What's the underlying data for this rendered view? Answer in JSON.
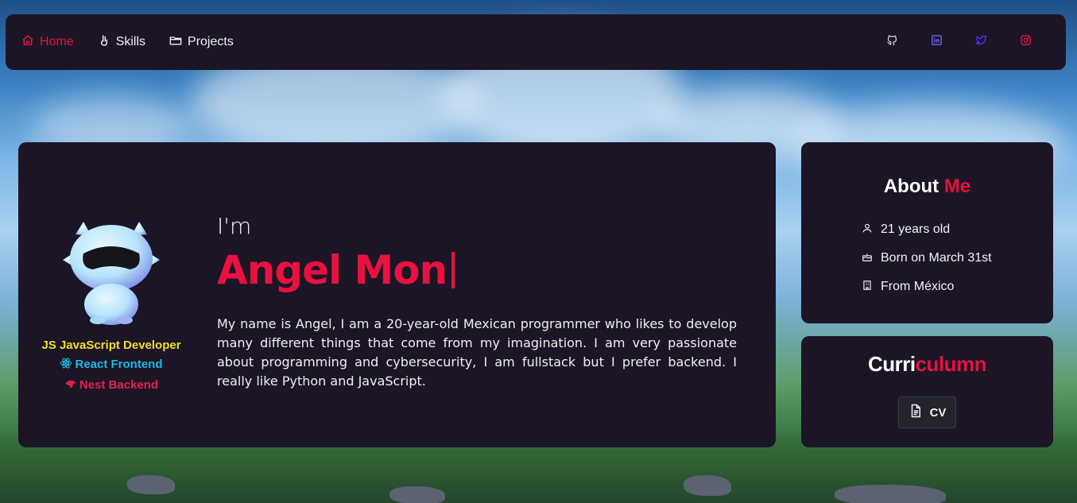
{
  "nav": {
    "items": [
      {
        "label": "Home",
        "icon": "home-icon",
        "active": true
      },
      {
        "label": "Skills",
        "icon": "hand-icon",
        "active": false
      },
      {
        "label": "Projects",
        "icon": "folder-icon",
        "active": false
      }
    ],
    "socials": [
      {
        "icon": "github-icon",
        "color": "#d9d9d9"
      },
      {
        "icon": "linkedin-icon",
        "color": "#6a63ff"
      },
      {
        "icon": "twitter-icon",
        "color": "#5a2bff"
      },
      {
        "icon": "instagram-icon",
        "color": "#e8113f"
      }
    ]
  },
  "hero": {
    "tags": {
      "js": "JavaScript Developer",
      "js_badge": "JS",
      "react": "React Frontend",
      "nest": "Nest Backend"
    },
    "intro": "I'm",
    "name": "Angel Mon",
    "bio": "My name is Angel, I am a 20-year-old Mexican programmer who likes to develop many different things that come from my imagination. I am very passionate about programming and cybersecurity, I am fullstack but I prefer backend. I really like Python and JavaScript."
  },
  "about": {
    "title_main": "About",
    "title_accent": "Me",
    "items": [
      {
        "icon": "user-icon",
        "text": "21 years old"
      },
      {
        "icon": "cake-icon",
        "text": "Born on March 31st"
      },
      {
        "icon": "building-icon",
        "text": "From México"
      }
    ]
  },
  "cv": {
    "title_main": "Curri",
    "title_accent": "culumn",
    "button_label": "CV"
  },
  "colors": {
    "accent": "#e8113f",
    "card_bg": "#1c1526",
    "js": "#f3de2c",
    "react": "#1fb8e6",
    "nest": "#e0234e"
  }
}
